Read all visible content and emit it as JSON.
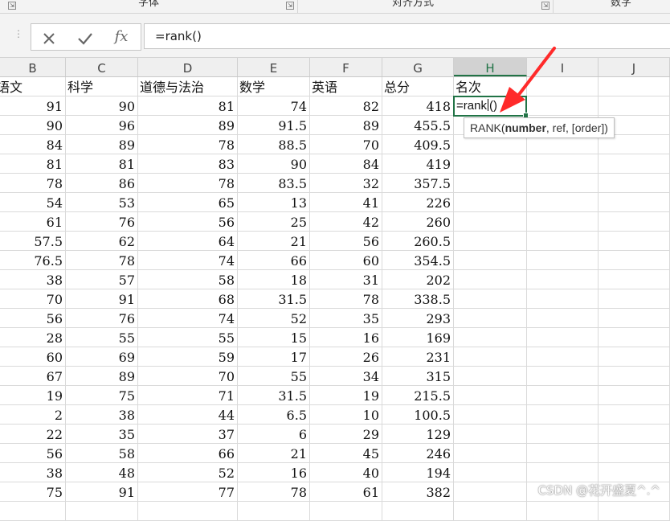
{
  "ribbon": {
    "groups": [
      {
        "label": "字体"
      },
      {
        "label": "对齐方式"
      },
      {
        "label": "数字"
      }
    ]
  },
  "formula_bar": {
    "cancel_icon": "x-icon",
    "enter_icon": "check-icon",
    "fx_label": "fx",
    "value": "=rank()"
  },
  "columns": [
    "B",
    "C",
    "D",
    "E",
    "F",
    "G",
    "H",
    "I",
    "J"
  ],
  "selected_column": "H",
  "headers": [
    "语文",
    "科学",
    "道德与法治",
    "数学",
    "英语",
    "总分",
    "名次"
  ],
  "rows": [
    [
      "91",
      "90",
      "81",
      "74",
      "82",
      "418"
    ],
    [
      "90",
      "96",
      "89",
      "91.5",
      "89",
      "455.5"
    ],
    [
      "84",
      "89",
      "78",
      "88.5",
      "70",
      "409.5"
    ],
    [
      "81",
      "81",
      "83",
      "90",
      "84",
      "419"
    ],
    [
      "78",
      "86",
      "78",
      "83.5",
      "32",
      "357.5"
    ],
    [
      "54",
      "53",
      "65",
      "13",
      "41",
      "226"
    ],
    [
      "61",
      "76",
      "56",
      "25",
      "42",
      "260"
    ],
    [
      "57.5",
      "62",
      "64",
      "21",
      "56",
      "260.5"
    ],
    [
      "76.5",
      "78",
      "74",
      "66",
      "60",
      "354.5"
    ],
    [
      "38",
      "57",
      "58",
      "18",
      "31",
      "202"
    ],
    [
      "70",
      "91",
      "68",
      "31.5",
      "78",
      "338.5"
    ],
    [
      "56",
      "76",
      "74",
      "52",
      "35",
      "293"
    ],
    [
      "28",
      "55",
      "55",
      "15",
      "16",
      "169"
    ],
    [
      "60",
      "69",
      "59",
      "17",
      "26",
      "231"
    ],
    [
      "67",
      "89",
      "70",
      "55",
      "34",
      "315"
    ],
    [
      "19",
      "75",
      "71",
      "31.5",
      "19",
      "215.5"
    ],
    [
      "2",
      "38",
      "44",
      "6.5",
      "10",
      "100.5"
    ],
    [
      "22",
      "35",
      "37",
      "6",
      "29",
      "129"
    ],
    [
      "56",
      "58",
      "66",
      "21",
      "45",
      "246"
    ],
    [
      "38",
      "48",
      "52",
      "16",
      "40",
      "194"
    ],
    [
      "75",
      "91",
      "77",
      "78",
      "61",
      "382"
    ]
  ],
  "active_cell": {
    "text_before": "=rank",
    "text_after": "()",
    "fill_handle": true
  },
  "tooltip": {
    "prefix": "RANK(",
    "bold_arg": "number",
    "rest": ", ref, [order])"
  },
  "colors": {
    "accent": "#217346",
    "arrow": "#ff2a2a"
  },
  "watermark": "CSDN @花开盛夏^.^"
}
